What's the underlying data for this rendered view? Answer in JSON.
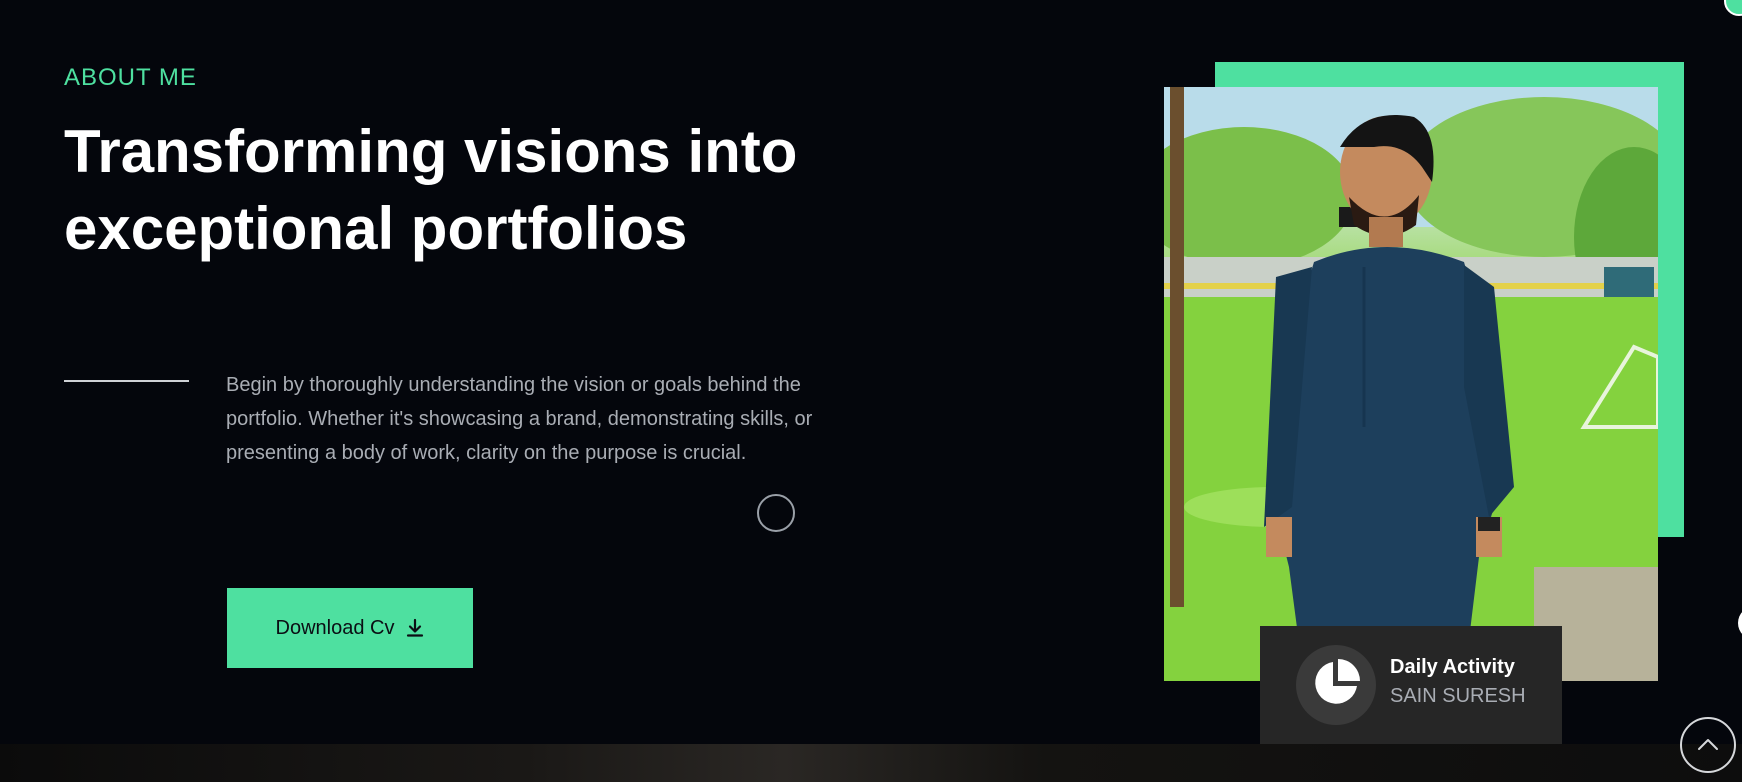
{
  "section": {
    "eyebrow": "ABOUT ME",
    "headline_line1": "Transforming visions into",
    "headline_line2": "exceptional portfolios",
    "body": "Begin by thoroughly understanding the vision or goals behind the portfolio. Whether it's showcasing a brand, demonstrating skills, or presenting a body of work, clarity on the purpose is crucial."
  },
  "download_button": {
    "label": "Download Cv",
    "icon": "download-icon"
  },
  "activity_card": {
    "title": "Daily Activity",
    "subtitle": "SAIN SURESH",
    "icon": "pie-chart-icon"
  },
  "scroll_top": {
    "icon": "chevron-up-icon"
  },
  "colors": {
    "background": "#04060c",
    "accent": "#4ee0a0",
    "text": "#ffffff",
    "muted_text": "#a9adb4",
    "card": "#262626"
  }
}
